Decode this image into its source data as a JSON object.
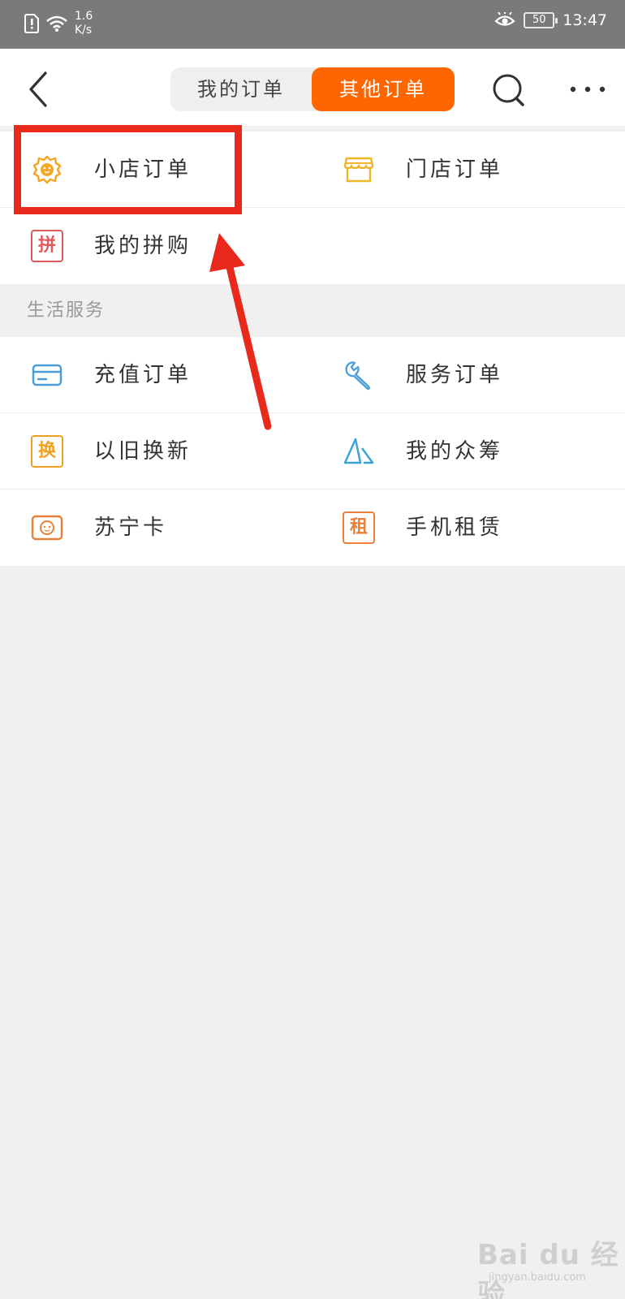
{
  "status_bar": {
    "net_speed_top": "1.6",
    "net_speed_bottom": "K/s",
    "battery": "50",
    "time": "13:47"
  },
  "nav": {
    "tabs": [
      {
        "label": "我的订单",
        "active": false
      },
      {
        "label": "其他订单",
        "active": true
      }
    ],
    "accent_color": "#ff6600"
  },
  "orders": {
    "items": [
      {
        "label": "小店订单",
        "icon": "shop-mascot-icon"
      },
      {
        "label": "门店订单",
        "icon": "storefront-icon"
      },
      {
        "label": "我的拼购",
        "icon": "pin-group-buy-icon",
        "glyph": "拼"
      }
    ]
  },
  "life_services": {
    "title": "生活服务",
    "items": [
      {
        "label": "充值订单",
        "icon": "card-icon"
      },
      {
        "label": "服务订单",
        "icon": "wrench-icon"
      },
      {
        "label": "以旧换新",
        "icon": "trade-in-icon",
        "glyph": "换"
      },
      {
        "label": "我的众筹",
        "icon": "crowdfunding-icon"
      },
      {
        "label": "苏宁卡",
        "icon": "suning-card-icon"
      },
      {
        "label": "手机租赁",
        "icon": "phone-rental-icon",
        "glyph": "租"
      }
    ]
  },
  "watermark": {
    "brand": "Bai du 经验",
    "url": "jingyan.baidu.com"
  },
  "annotation_color": "#e8291c"
}
